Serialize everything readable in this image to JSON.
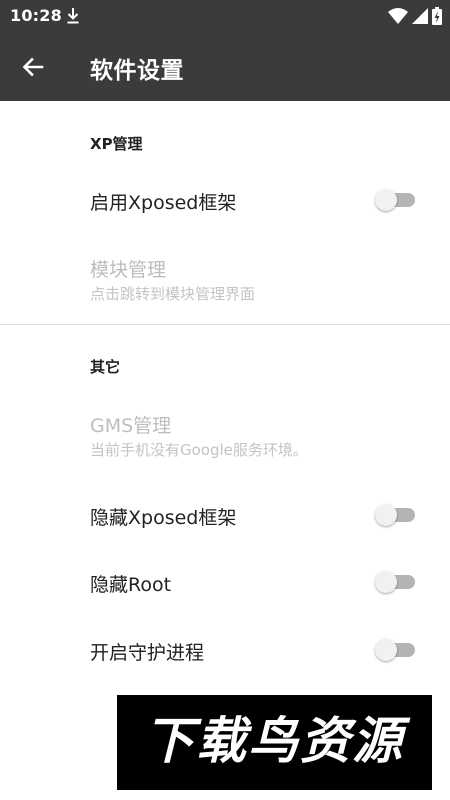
{
  "status_bar": {
    "time": "10:28",
    "icons": [
      "download-icon",
      "wifi-icon",
      "signal-icon",
      "battery-icon"
    ]
  },
  "app_bar": {
    "back_icon": "arrow-left-icon",
    "title": "软件设置"
  },
  "sections": {
    "xp": {
      "header": "XP管理",
      "enable_xposed": {
        "title": "启用Xposed框架",
        "checked": false
      },
      "module_management": {
        "title": "模块管理",
        "summary": "点击跳转到模块管理界面",
        "enabled": false
      }
    },
    "other": {
      "header": "其它",
      "gms_management": {
        "title": "GMS管理",
        "summary": "当前手机没有Google服务环境。",
        "enabled": false
      },
      "hide_xposed": {
        "title": "隐藏Xposed框架",
        "checked": false
      },
      "hide_root": {
        "title": "隐藏Root",
        "checked": false
      },
      "guard_process": {
        "title": "开启守护进程",
        "checked": false
      }
    }
  },
  "watermark": {
    "text": "下载鸟资源"
  },
  "colors": {
    "app_bar": "#3b3b3b",
    "disabled_text": "#bdbdbd",
    "switch_track_off": "#b4b4b4",
    "switch_thumb_off": "#f1f1f1"
  }
}
